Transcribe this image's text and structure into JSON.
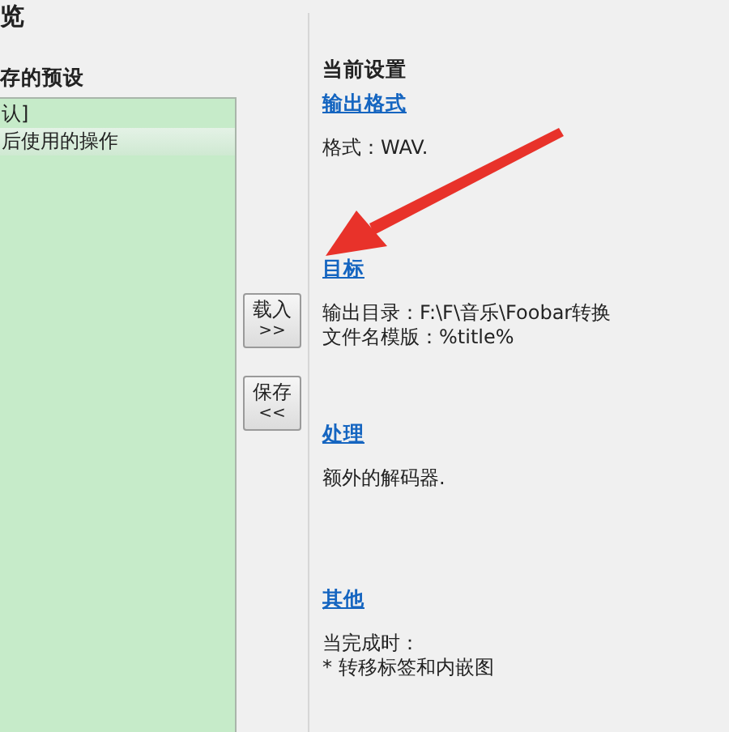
{
  "window": {
    "title": "览"
  },
  "presets": {
    "label": "存的预设",
    "items": [
      {
        "label": "认]",
        "selected": false
      },
      {
        "label": "后使用的操作",
        "selected": true
      }
    ]
  },
  "buttons": [
    {
      "label": "载入",
      "arrow": ">>"
    },
    {
      "label": "保存",
      "arrow": "<<"
    }
  ],
  "settings": {
    "title": "当前设置",
    "sections": [
      {
        "heading": "输出格式",
        "lines": [
          "格式：WAV."
        ]
      },
      {
        "heading": "目标",
        "lines": [
          "输出目录：F:\\F\\音乐\\Foobar转换",
          "文件名模版：%title%"
        ]
      },
      {
        "heading": "处理",
        "lines": [
          "额外的解码器."
        ]
      },
      {
        "heading": "其他",
        "lines": [
          "当完成时：",
          "* 转移标签和内嵌图"
        ]
      }
    ]
  },
  "annotation": {
    "kind": "arrow"
  }
}
